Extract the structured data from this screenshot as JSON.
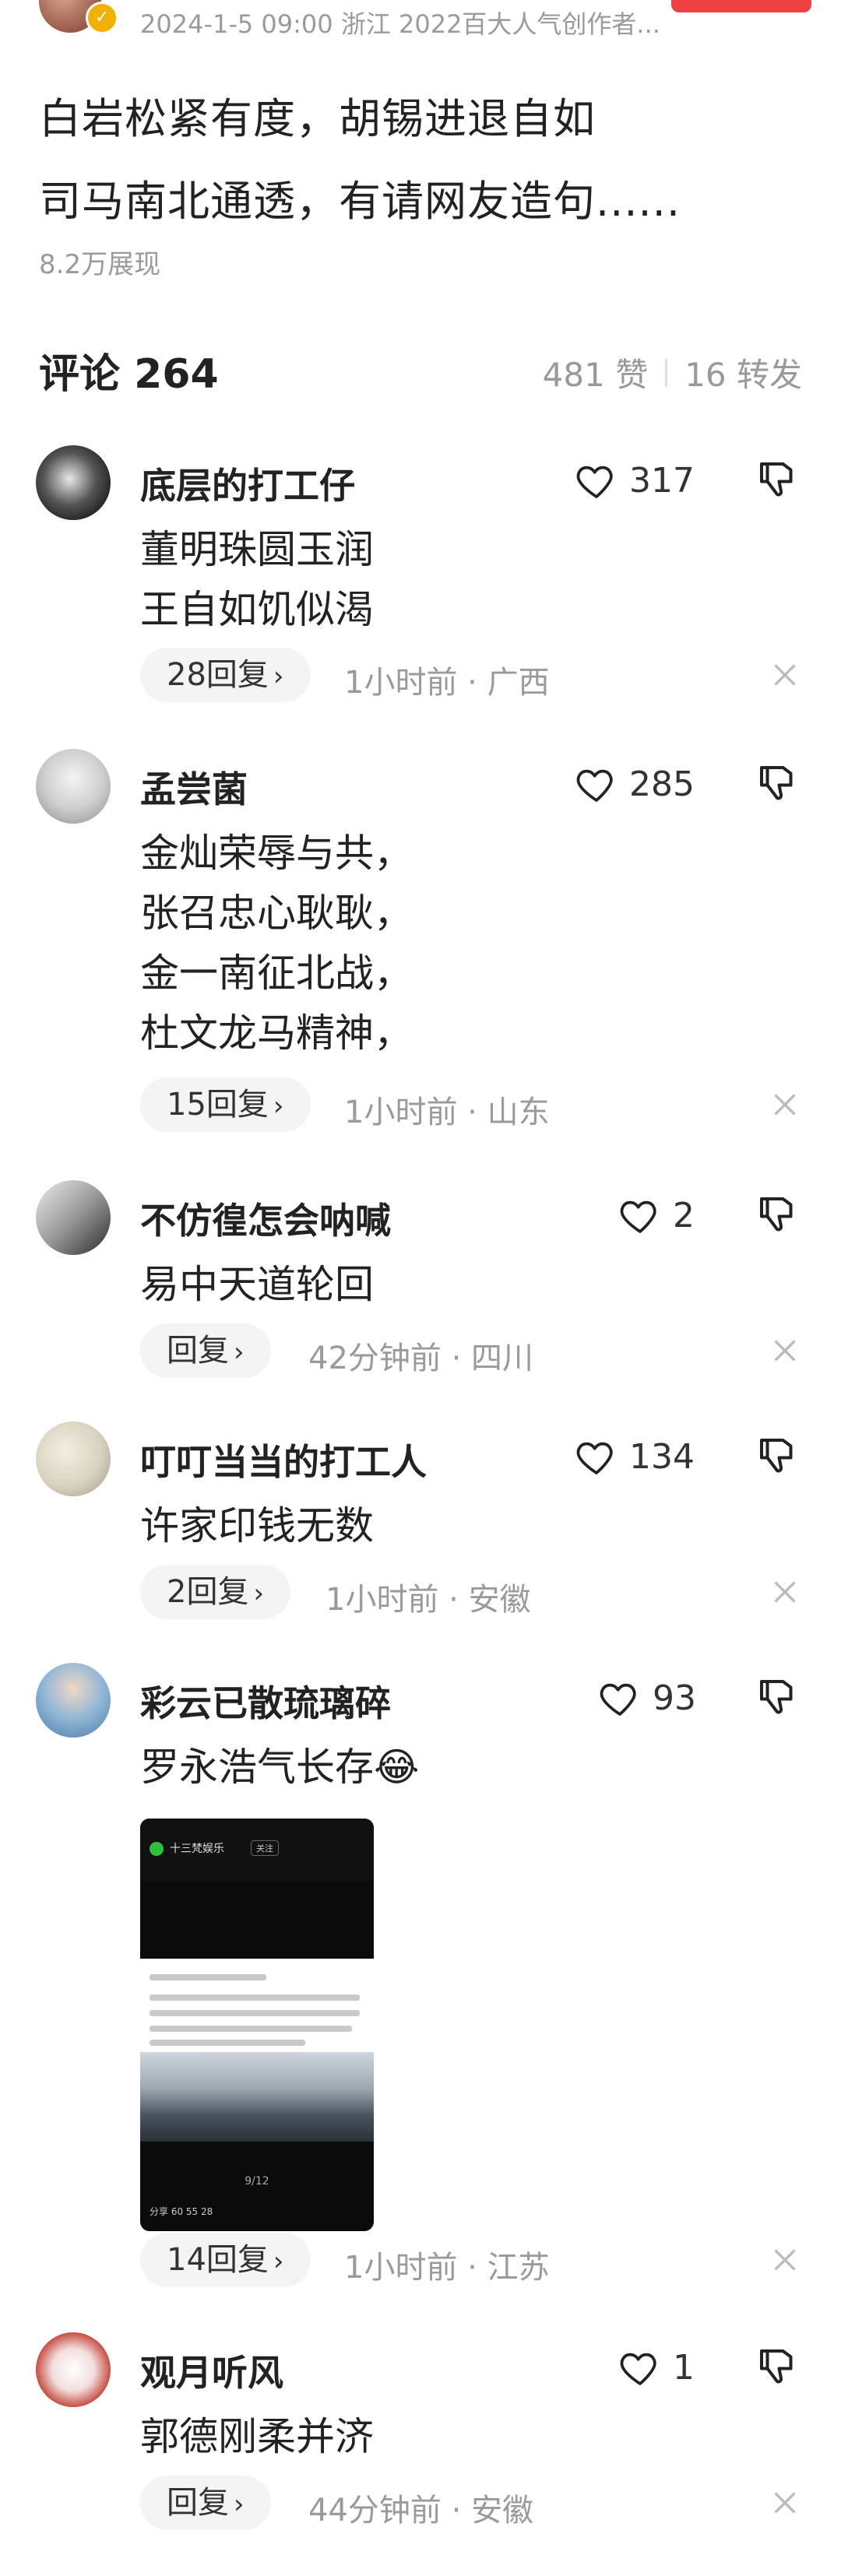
{
  "header": {
    "meta": "2024-1-5 09:00 浙江 2022百大人气创作者...",
    "follow_color": "#f04142",
    "verify_badge_color": "#f2b100"
  },
  "post": {
    "line1": "白岩松紧有度，胡锡进退自如",
    "line2": "司马南北通透，有请网友造句......",
    "views": "8.2万展现"
  },
  "stats": {
    "comments_label": "评论 264",
    "likes": "481 赞",
    "shares": "16 转发"
  },
  "comments": [
    {
      "name": "底层的打工仔",
      "likes": "317",
      "lines": [
        "董明珠圆玉润",
        "王自如饥似渴"
      ],
      "reply": "28回复",
      "time": "1小时前 · 广西"
    },
    {
      "name": "孟尝菌",
      "likes": "285",
      "lines": [
        "金灿荣辱与共，",
        "张召忠心耿耿，",
        "金一南征北战，",
        "杜文龙马精神，"
      ],
      "reply": "15回复",
      "time": "1小时前 · 山东"
    },
    {
      "name": "不仿徨怎会呐喊",
      "likes": "2",
      "lines": [
        "易中天道轮回"
      ],
      "reply": "回复",
      "time": "42分钟前 · 四川"
    },
    {
      "name": "叮叮当当的打工人",
      "likes": "134",
      "lines": [
        "许家印钱无数"
      ],
      "reply": "2回复",
      "time": "1小时前 · 安徽"
    },
    {
      "name": "彩云已散琉璃碎",
      "likes": "93",
      "lines": [
        "罗永浩气长存😂"
      ],
      "reply": "14回复",
      "time": "1小时前 · 江苏",
      "image": {
        "account": "十三梵娱乐",
        "follow": "关注",
        "page": "9/12",
        "actions": "分享  60  55  28"
      }
    },
    {
      "name": "观月听风",
      "likes": "1",
      "lines": [
        "郭德刚柔并济"
      ],
      "reply": "回复",
      "time": "44分钟前 · 安徽"
    }
  ]
}
